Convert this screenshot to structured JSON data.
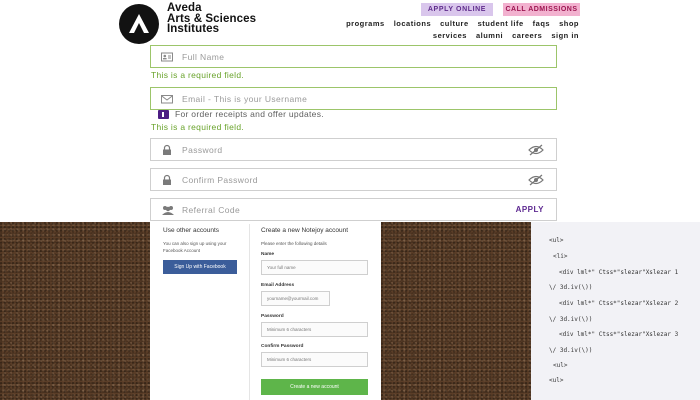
{
  "header": {
    "logo_lines": [
      "Aveda",
      "Arts & Sciences",
      "Institutes"
    ],
    "apply_online": "APPLY ONLINE",
    "call_admissions": "CALL ADMISSIONS",
    "nav_row1": [
      "programs",
      "locations",
      "culture",
      "student life",
      "faqs",
      "shop"
    ],
    "nav_row2": [
      "services",
      "alumni",
      "careers",
      "sign in"
    ]
  },
  "form": {
    "full_name_placeholder": "Full Name",
    "required_message": "This is a required field.",
    "email_placeholder": "Email - This is your Username",
    "optin_text": "For order receipts and offer updates.",
    "password_placeholder": "Password",
    "confirm_password_placeholder": "Confirm Password",
    "referral_placeholder": "Referral Code",
    "apply_link": "APPLY"
  },
  "modal": {
    "left_title": "Use other accounts",
    "left_text": "You can also sign up using your Facebook Account",
    "facebook_button": "Sign Up with Facebook",
    "right_title": "Create a new Notejoy account",
    "right_sub": "Please enter the following details",
    "name_label": "Name",
    "name_placeholder": "Your full name",
    "email_label": "Email Address",
    "email_placeholder": "yourname@yourmail.com",
    "password_label": "Password",
    "password_placeholder": "Minimum 6 characters",
    "confirm_label": "Confirm Password",
    "confirm_placeholder": "Minimum 6 characters",
    "create_button": "Create a new account"
  },
  "code_panel": {
    "lines": [
      "<ul>",
      "<li>",
      "<div lml*\" Ctss*\"slezar\"Xslezar 1",
      "\\/ 3d.iv(\\))",
      "<div lml*\" Ctss*\"slezar\"Xslezar 2",
      "\\/ 3d.iv(\\))",
      "<div lml*\" Ctss*\"slezar\"Xslezar 3",
      "\\/ 3d.iv(\\))",
      "<ul>",
      "<ul>"
    ]
  },
  "colors": {
    "brand_purple": "#5e2a91",
    "error_green": "#69a32b",
    "facebook_blue": "#3b5d9a",
    "create_green": "#5eb54a"
  }
}
